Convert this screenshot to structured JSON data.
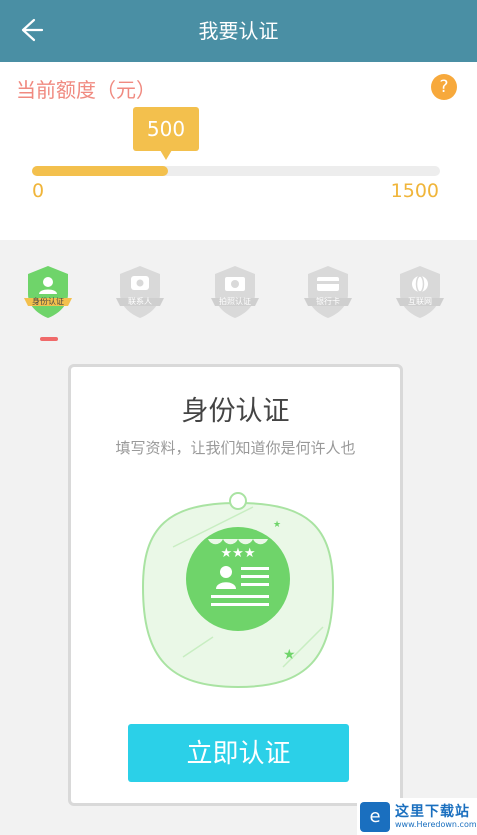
{
  "header": {
    "title": "我要认证",
    "back_icon": "arrow-left-icon"
  },
  "credit": {
    "label": "当前额度（元）",
    "help_icon": "?",
    "current_value": "500",
    "min_label": "0",
    "max_label": "1500",
    "progress_fraction": 0.333
  },
  "steps": [
    {
      "label": "身份认证",
      "icon": "person-icon",
      "active": true
    },
    {
      "label": "联系人",
      "icon": "phone-icon",
      "active": false
    },
    {
      "label": "拍照认证",
      "icon": "camera-icon",
      "active": false
    },
    {
      "label": "银行卡",
      "icon": "card-icon",
      "active": false
    },
    {
      "label": "互联网",
      "icon": "globe-icon",
      "active": false
    }
  ],
  "card": {
    "title": "身份认证",
    "subtitle": "填写资料，让我们知道你是何许人也",
    "button": "立即认证"
  },
  "watermark": {
    "title": "这里下载站",
    "url": "www.Heredown.com"
  },
  "colors": {
    "header": "#4a8fa4",
    "accent_yellow": "#f3c04d",
    "accent_green": "#6fd46a",
    "button": "#2bd0e8",
    "label_pink": "#f08a80"
  }
}
